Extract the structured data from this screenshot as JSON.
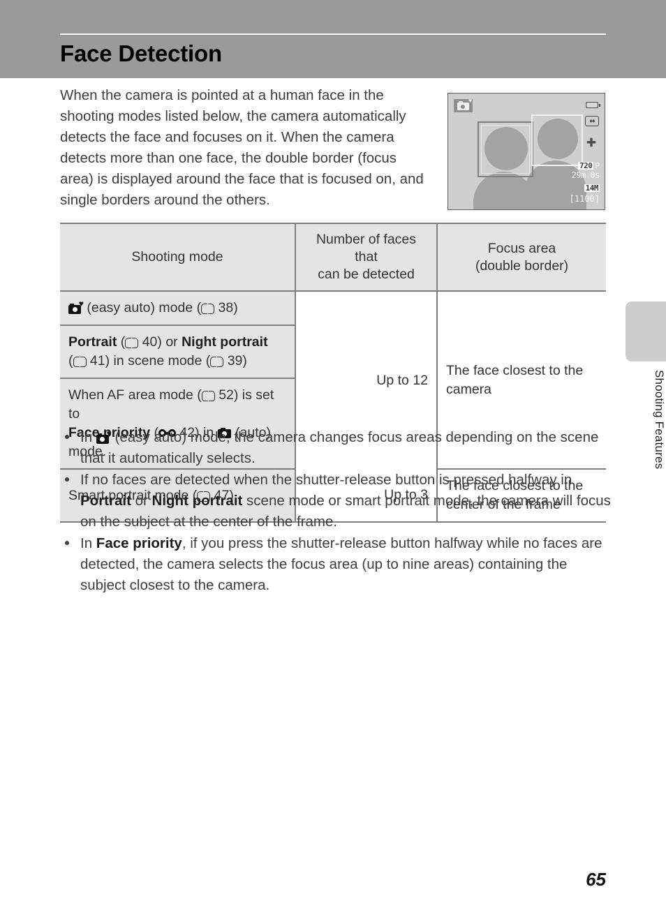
{
  "header": {
    "title": "Face Detection"
  },
  "intro": {
    "paragraph": "When the camera is pointed at a human face in the shooting modes listed below, the camera automatically detects the face and focuses on it. When the camera detects more than one face, the double border (focus area) is displayed around the face that is focused on, and single borders around the others."
  },
  "lcd": {
    "mode_icon": "easy-auto-icon",
    "battery_icon": "battery-icon",
    "vr_icon": "vibration-reduction-icon",
    "shake_icon": "camera-shake-warning-icon",
    "movie_quality": "720",
    "movie_quality_suffix": "P",
    "record_time": "29m 0s",
    "image_size": "14M",
    "shots_remaining": "[1100]"
  },
  "table": {
    "headers": {
      "shooting_mode": "Shooting mode",
      "faces_line1": "Number of faces that",
      "faces_line2": "can be detected",
      "focus_line1": "Focus area",
      "focus_line2": "(double border)"
    },
    "rows": [
      {
        "mode_prefix": "",
        "mode_text_1": "(easy auto) mode (",
        "mode_page": "38",
        "mode_text_2": ")"
      },
      {
        "bold_1": "Portrait",
        "text_1": "(",
        "page_1": "40",
        "text_2": ") or ",
        "bold_2": "Night portrait",
        "text_3": "(",
        "page_2": "41",
        "text_4": ") in scene mode (",
        "page_3": "39",
        "text_5": ")"
      },
      {
        "text_1": "When AF area mode (",
        "page_1": "52",
        "text_2": ") is set to ",
        "bold_1": "Face priority",
        "text_3": "(",
        "page_2": "42",
        "text_4": ") in ",
        "text_5": "(auto) mode."
      },
      {
        "text_1": "Smart portrait mode (",
        "page_1": "47",
        "text_2": ")"
      }
    ],
    "faces_group_1": "Up to 12",
    "faces_group_2": "Up to 3",
    "focus_group_1": "The face closest to the camera",
    "focus_group_2": "The face closest to the center of the frame"
  },
  "bullets": [
    {
      "pre": "In ",
      "icon": "easy-auto-icon",
      "post": "(easy auto) mode, the camera changes focus areas depending on the scene that it automatically selects."
    },
    {
      "t1": "If no faces are detected when the shutter-release button is pressed halfway in ",
      "b1": "Portrait",
      "t2": " or ",
      "b2": "Night portrait",
      "t3": " scene mode or smart portrait mode, the camera will focus on the subject at the center of the frame."
    },
    {
      "t1": "In ",
      "b1": "Face priority",
      "t2": ", if you press the shutter-release button halfway while no faces are detected, the camera selects the focus area (up to nine areas) containing the subject closest to the camera."
    }
  ],
  "side_tab": {
    "label": "Shooting Features"
  },
  "footer": {
    "page_number": "65"
  },
  "colors": {
    "header_band": "#9a9a9a",
    "table_shade": "#e4e4e4",
    "rule": "#7e7e7e",
    "side_tab": "#cdcdcd",
    "lcd_background": "#cfcfcf",
    "lcd_figure": "#a3a3a3"
  }
}
